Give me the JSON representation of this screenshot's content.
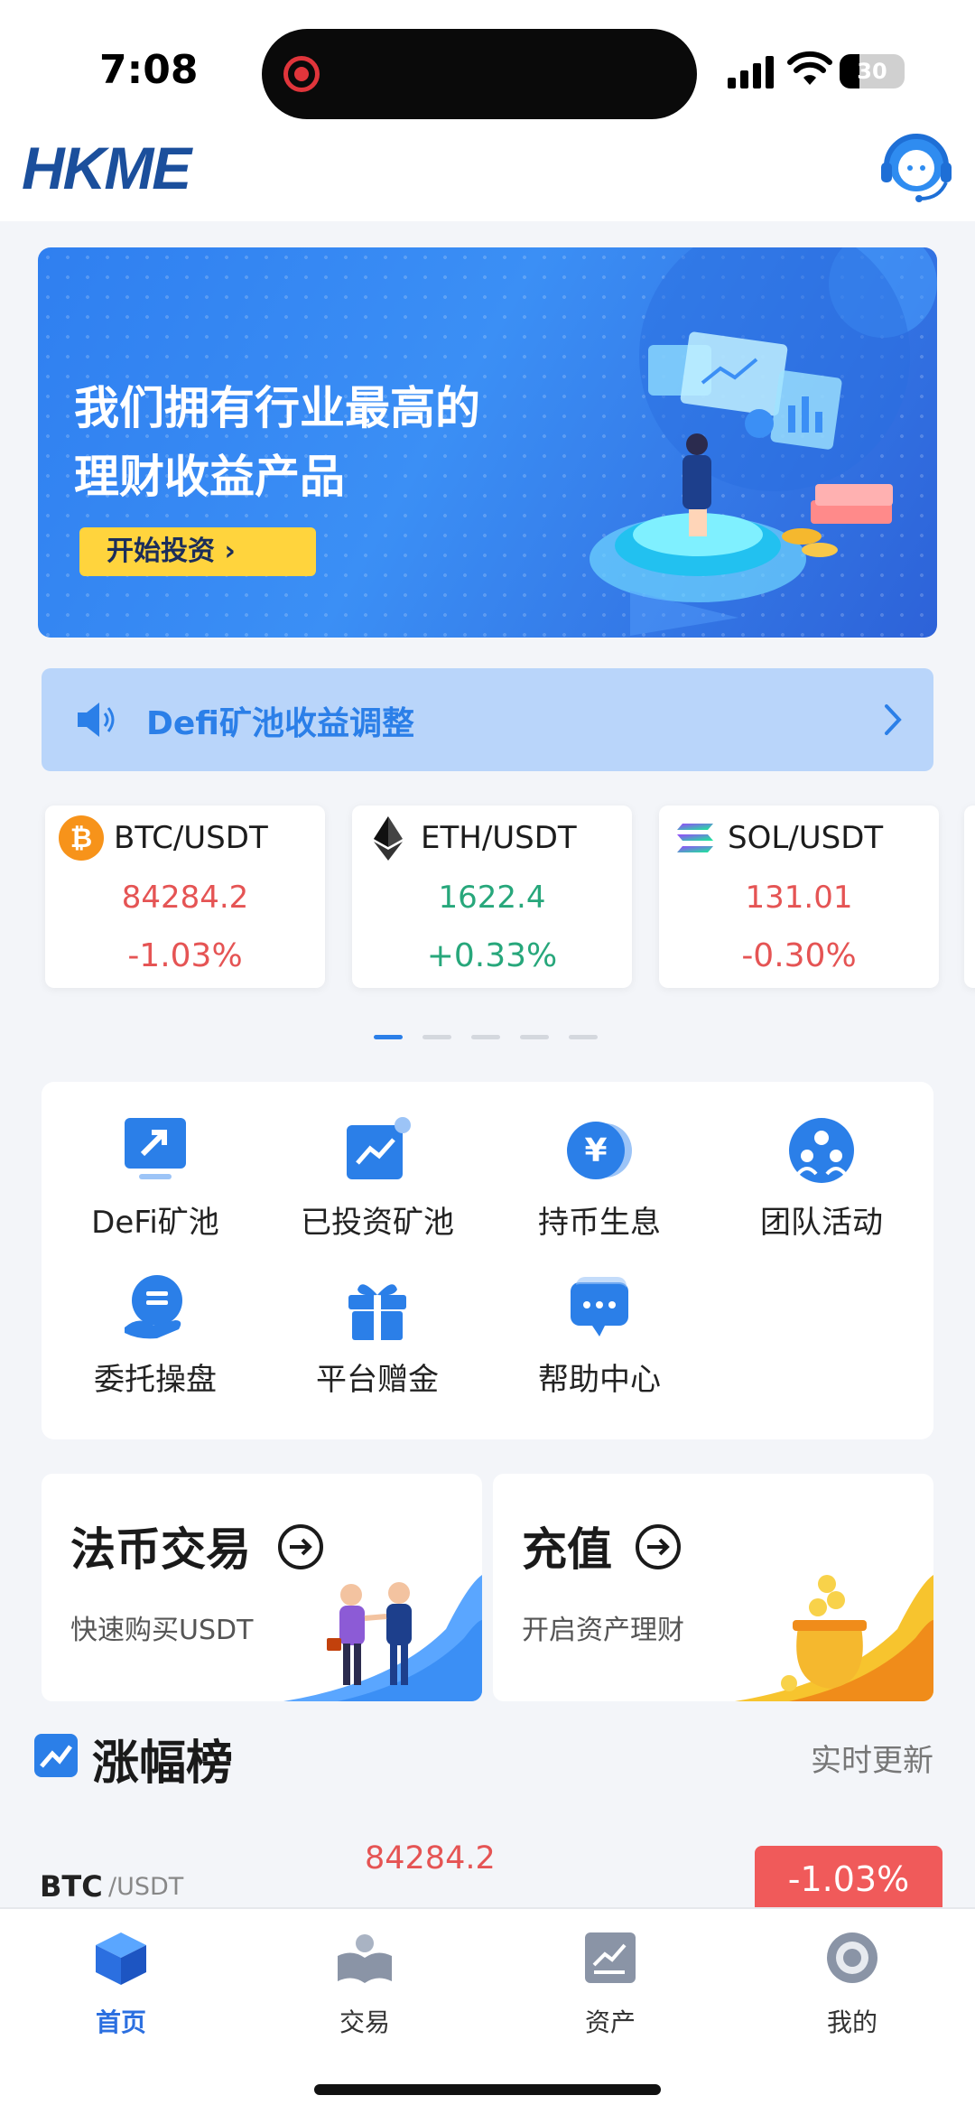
{
  "status_bar": {
    "time": "7:08",
    "battery": "30",
    "battery_level": 0.3
  },
  "header": {
    "logo": "HKME"
  },
  "banner": {
    "title_line1": "我们拥有行业最高的",
    "title_line2": "理财收益产品",
    "button": "开始投资 ›"
  },
  "notice": {
    "text": "Defi矿池收益调整"
  },
  "ticker": [
    {
      "pair": "BTC/USDT",
      "price": "84284.2",
      "change": "-1.03%",
      "icon": "bitcoin-icon"
    },
    {
      "pair": "ETH/USDT",
      "price": "1622.4",
      "change": "+0.33%",
      "icon": "ethereum-icon"
    },
    {
      "pair": "SOL/USDT",
      "price": "131.01",
      "change": "-0.30%",
      "icon": "solana-icon"
    }
  ],
  "features": [
    {
      "label": "DeFi矿池",
      "icon": "defi-pool-icon"
    },
    {
      "label": "已投资矿池",
      "icon": "invested-pool-icon"
    },
    {
      "label": "持币生息",
      "icon": "yen-coin-icon"
    },
    {
      "label": "团队活动",
      "icon": "team-icon"
    },
    {
      "label": "委托操盘",
      "icon": "entrust-icon"
    },
    {
      "label": "平台赠金",
      "icon": "gift-icon"
    },
    {
      "label": "帮助中心",
      "icon": "help-chat-icon"
    }
  ],
  "quick": {
    "fiat": {
      "title": "法币交易",
      "subtitle": "快速购买USDT"
    },
    "deposit": {
      "title": "充值",
      "subtitle": "开启资产理财"
    }
  },
  "gainers": {
    "title": "涨幅榜",
    "update": "实时更新",
    "rows": [
      {
        "symbol": "BTC",
        "quote": "/USDT",
        "price": "84284.2",
        "change": "-1.03%"
      }
    ]
  },
  "tabs": [
    {
      "label": "首页",
      "icon": "home-cube-icon",
      "active": true
    },
    {
      "label": "交易",
      "icon": "trade-book-icon",
      "active": false
    },
    {
      "label": "资产",
      "icon": "assets-chart-icon",
      "active": false
    },
    {
      "label": "我的",
      "icon": "profile-coin-icon",
      "active": false
    }
  ],
  "colors": {
    "accent": "#2b7fe8",
    "down": "#e55454",
    "up": "#27a77b",
    "banner_button": "#ffd43d"
  }
}
